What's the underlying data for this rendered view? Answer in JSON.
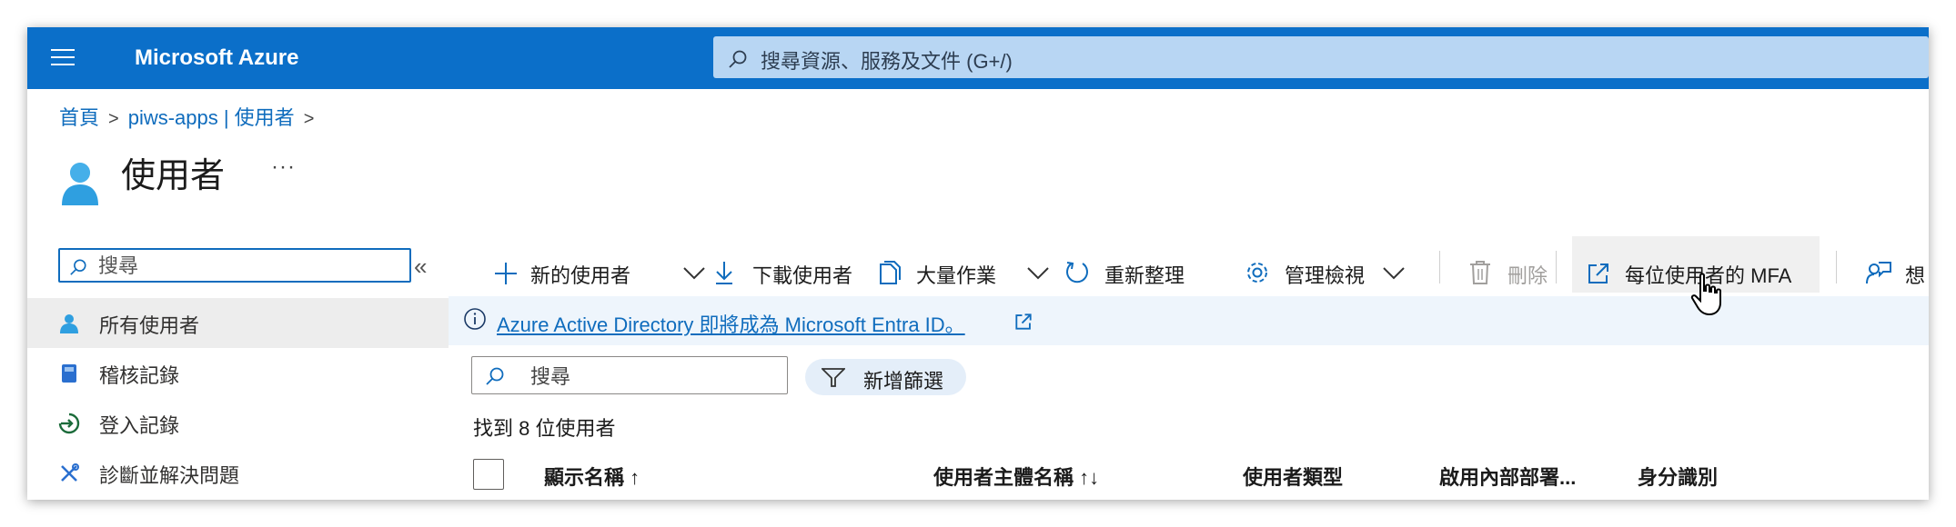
{
  "header": {
    "brand": "Microsoft Azure",
    "search_placeholder": "搜尋資源、服務及文件 (G+/)"
  },
  "breadcrumb": [
    "首頁",
    "piws-apps | 使用者"
  ],
  "page": {
    "title": "使用者",
    "more": "···"
  },
  "nav": {
    "search_placeholder": "搜尋",
    "collapse": "«",
    "items": [
      {
        "label": "所有使用者",
        "icon": "user-icon",
        "selected": true
      },
      {
        "label": "稽核記錄",
        "icon": "audit-log-icon",
        "selected": false
      },
      {
        "label": "登入記錄",
        "icon": "sign-in-icon",
        "selected": false
      },
      {
        "label": "診斷並解決問題",
        "icon": "wrench-icon",
        "selected": false
      }
    ]
  },
  "commands": {
    "new_user": "新的使用者",
    "download": "下載使用者",
    "bulk": "大量作業",
    "refresh": "重新整理",
    "manage_view": "管理檢視",
    "delete": "刪除",
    "mfa": "每位使用者的 MFA",
    "feedback": "想"
  },
  "banner": {
    "text": "Azure Active Directory 即將成為 Microsoft Entra ID。"
  },
  "filter": {
    "search_placeholder": "搜尋",
    "add_filter": "新增篩選"
  },
  "results": {
    "count_text": "找到 8 位使用者"
  },
  "table": {
    "columns": [
      "顯示名稱 ↑",
      "使用者主體名稱 ↑↓",
      "使用者類型",
      "啟用內部部署...",
      "身分識別"
    ]
  },
  "colors": {
    "azure_blue": "#0b6fc9",
    "link": "#0f6cbd",
    "banner_bg": "#eef5fc"
  }
}
